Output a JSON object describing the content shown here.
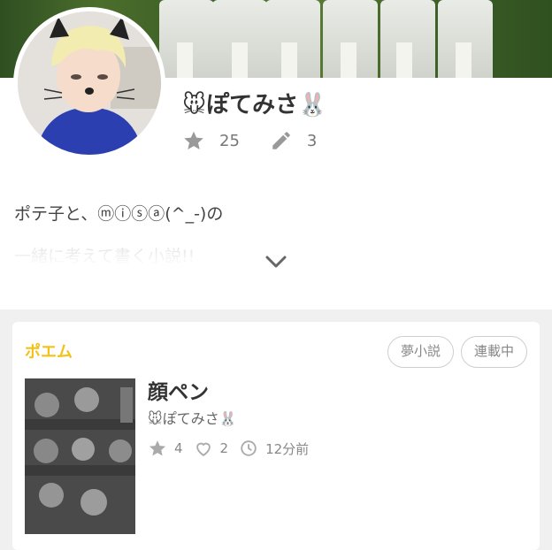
{
  "profile": {
    "username": "🐭ぽてみさ🐰",
    "stats": {
      "stars": "25",
      "posts": "3"
    },
    "bio": {
      "line1": "ポテ子と、ⓜⓘⓢⓐ(^_-)の",
      "line2": "一緒に考えて書く小説!!"
    }
  },
  "work": {
    "genre": "ポエム",
    "tags": [
      "夢小説",
      "連載中"
    ],
    "title": "顔ペン",
    "author": "🐭ぽてみさ🐰",
    "stars": "4",
    "likes": "2",
    "updated": "12分前"
  },
  "colors": {
    "accent": "#f3c219",
    "icon": "#999999",
    "background": "#f0f0f0"
  },
  "icons": [
    "star-icon",
    "pencil-icon",
    "chevron-down-icon",
    "heart-icon",
    "clock-icon"
  ]
}
